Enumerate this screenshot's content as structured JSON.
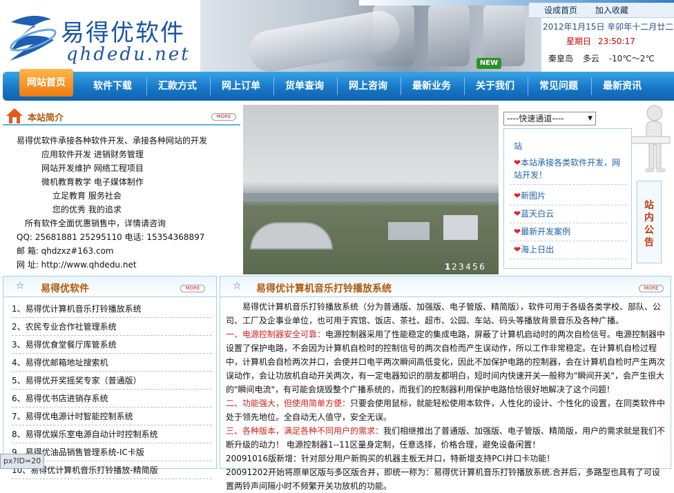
{
  "header": {
    "logo_cn": "易得优软件",
    "logo_en": "qhdedu.net",
    "toplinks": [
      "设成首页",
      "加入收藏"
    ],
    "date": "2012年1月15日  辛卯年十二月廿二",
    "weekday": "星期日",
    "time": "23:50:17",
    "city": "秦皇岛",
    "weather": "多云",
    "temp": "-10℃～2℃",
    "new_badge": "NEW"
  },
  "nav": [
    "网站首页",
    "软件下载",
    "汇款方式",
    "网上订单",
    "货单查询",
    "网上咨询",
    "最新业务",
    "关于我们",
    "常见问题",
    "最新资讯"
  ],
  "intro": {
    "title": "本站简介",
    "more": "MORE",
    "lines": [
      "易得优软件承接各种软件开发、承接各种网站的开发",
      "应用软件开发    进销财务管理",
      "网站开发维护    网络工程项目",
      "微机教育教学    电子媒体制作",
      "立足教育        服务社会",
      "您的优秀        我的追求",
      "所有软件全面优惠销售中，详情请咨询",
      "QQ: 25681881 25295110   电话:  15354368897",
      "邮  箱:  qhdzxz#163.com",
      "网  址:  http://www.qhdedu.net"
    ]
  },
  "photo": {
    "pager": [
      "1",
      "2",
      "3",
      "4",
      "5",
      "6"
    ]
  },
  "quick": {
    "label": "----快速通道----",
    "arrow": "▼"
  },
  "notice": {
    "side_label": [
      "站",
      "内",
      "公",
      "告"
    ],
    "items": [
      "本站承接各类软件开发，网站开发！",
      "新图片",
      "蓝天白云",
      "最新开发案例",
      "海上日出"
    ],
    "partial_top": "站"
  },
  "soft": {
    "title": "易得优软件",
    "more": "MORE",
    "items": [
      "1、易得优计算机音乐打铃播放系统",
      "2、农民专业合作社管理系统",
      "3、易得优食堂餐厅库管系统",
      "4、易得优邮箱地址搜索机",
      "5、易得优开奖摇奖专家（普通版）",
      "6、易得优书店进销存系统",
      "7、易得优电源计时智能控制系统",
      "8、易得优娱乐室电源自动计时控制系统",
      "9、易得优油品销售管理系统-IC卡版",
      "10、易得优计算机音乐打铃播放-精简版"
    ]
  },
  "music": {
    "title": "易得优计算机音乐打铃播放系统",
    "more": "MORE",
    "p1": "易得优计算机音乐打铃播放系统（分为普通版、加强版、电子管版、精简版），软件可用于各级各类学校、部队、公司、工厂及企事业单位，也可用于宾馆、饭店、茶社、超市、公园、车站、码头等播放背景音乐及各种广播。",
    "h1": "一、电源控制器安全可靠：",
    "p2": "电源控制器采用了性能稳定的集成电路，屏蔽了计算机启动时的两次自检信号。电源控制器中设置了保护电路，不会因为计算机自检时的控制信号的两次自检而产生误动作，所以工作非常稳定。在计算机自检过程中，计算机会自检两次并口，会使并口电平两次瞬间高低变化，因此不加保护电路的控制器，会在计算机自检时产生两次误动作，会让功放机自动开关两次，有一定电器知识的朋友都明白，短时间内快速开关一般称为\"瞬间开关\"，会产生很大的\"瞬间电流\"，有可能会烧毁整个广播系统的，而我们的控制器利用保护电路恰恰很好地解决了这个问题！",
    "h2": "二、功能强大，但使用简单方便：",
    "p3": "只要会使用鼠标，就能轻松使用本软件，人性化的设计、个性化的设置，在同类软件中处于领先地位。全自动无人值守，安全无误。",
    "h3": "三、各种版本，满足各种不同用户的需求：",
    "p4": "我们相继推出了普通版、加强版、电子管版、精简版，用户的需求就是我们不断升级的动力！   电源控制器1--11区量身定制，任意选择，价格合理，避免设备闲置！",
    "p5": "20091016版新增：针对部分用户新购买的机器主板无并口，特新增支持PCI并口卡功能！",
    "p6": "20091202开始将原单区版与多区版合并，即统一称为：易得优计算机音乐打铃播放系统.合并后，多路型也具有了可设置两铃声间隔小时不频繁开关功放机的功能。"
  },
  "status": "px?ID=20",
  "colors": {
    "nav_blue": "#1878c8",
    "home_orange": "#f07a10",
    "title_brown": "#b0580a",
    "alert_red": "#d0201a"
  }
}
